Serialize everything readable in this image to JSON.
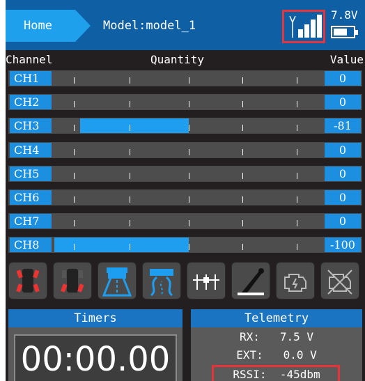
{
  "header": {
    "home_label": "Home",
    "model_label": "Model:model_1",
    "voltage": "7.8V",
    "signal_bars": 4,
    "battery_level": 0.6,
    "icons": [
      "antenna-icon",
      "signal-bars-icon",
      "battery-icon"
    ]
  },
  "columns": {
    "channel": "Channel",
    "quantity": "Quantity",
    "value": "Value"
  },
  "channels": [
    {
      "label": "CH1",
      "value": "0",
      "num": 0
    },
    {
      "label": "CH2",
      "value": "0",
      "num": 0
    },
    {
      "label": "CH3",
      "value": "-81",
      "num": -81
    },
    {
      "label": "CH4",
      "value": "0",
      "num": 0
    },
    {
      "label": "CH5",
      "value": "0",
      "num": 0
    },
    {
      "label": "CH6",
      "value": "0",
      "num": 0
    },
    {
      "label": "CH7",
      "value": "0",
      "num": 0
    },
    {
      "label": "CH8",
      "value": "-100",
      "num": -100
    }
  ],
  "mode_icons": [
    "four-wheel-steer-icon",
    "crab-steer-icon",
    "road-icon",
    "curvy-road-icon",
    "mixer-sliders-icon",
    "throttle-lever-icon",
    "engine-icon",
    "engine-off-icon"
  ],
  "timers": {
    "title": "Timers",
    "time": "00:00.00"
  },
  "telemetry": {
    "title": "Telemetry",
    "rx": "RX:   7.5 V",
    "ext": "EXT:   0.0 V",
    "rssi": "RSSI:  -45dbm"
  },
  "colors": {
    "accent": "#1d8fe0",
    "header": "#0f5fa5",
    "highlight": "#e8333b",
    "background": "#231f20"
  }
}
